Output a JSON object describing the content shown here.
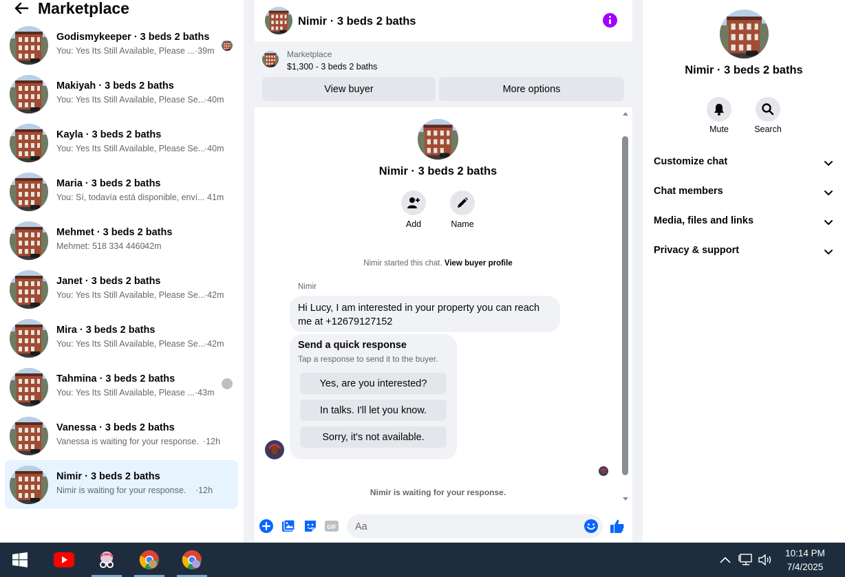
{
  "sidebar": {
    "title": "Marketplace",
    "conversations": [
      {
        "title": "Godismykeeper · 3 beds 2 baths",
        "sub": "You: Yes Its Still Available, Please ...",
        "time": "·39m"
      },
      {
        "title": "Makiyah · 3 beds 2 baths",
        "sub": "You: Yes Its Still Available, Please Se...",
        "time": "·40m"
      },
      {
        "title": "Kayla · 3 beds 2 baths",
        "sub": "You: Yes Its Still Available, Please Se...",
        "time": "·40m"
      },
      {
        "title": "Maria · 3 beds 2 baths",
        "sub": "You: Sí, todavía está disponible, enví...",
        "time": "41m"
      },
      {
        "title": "Mehmet · 3 beds 2 baths",
        "sub": "Mehmet: 518 334 4460",
        "time": "·42m"
      },
      {
        "title": "Janet · 3 beds 2 baths",
        "sub": "You: Yes Its Still Available, Please Se...",
        "time": "·42m"
      },
      {
        "title": "Mira · 3 beds 2 baths",
        "sub": "You: Yes Its Still Available, Please Se...",
        "time": "·42m"
      },
      {
        "title": "Tahmina · 3 beds 2 baths",
        "sub": "You: Yes Its Still Available, Please ...",
        "time": "·43m"
      },
      {
        "title": "Vanessa · 3 beds 2 baths",
        "sub": "Vanessa is waiting for your response.",
        "time": "·12h"
      },
      {
        "title": "Nimir · 3 beds 2 baths",
        "sub": "Nimir is waiting for your response.",
        "time": "·12h"
      }
    ]
  },
  "chat": {
    "title": "Nimir · 3 beds 2 baths",
    "marketplace_label": "Marketplace",
    "listing": "$1,300 - 3 beds 2 baths",
    "view_buyer": "View buyer",
    "more_options": "More options",
    "thread_name": "Nimir · 3 beds 2 baths",
    "add_label": "Add",
    "name_label": "Name",
    "started_text": "Nimir started this chat.",
    "view_profile": "View buyer profile",
    "sender": "Nimir",
    "message": "Hi Lucy, I am interested in your property you can reach me at +12679127152",
    "quick_title": "Send a quick response",
    "quick_sub": "Tap a response to send it to the buyer.",
    "quick_replies": [
      "Yes, are you interested?",
      "In talks. I'll let you know.",
      "Sorry, it's not available."
    ],
    "waiting": "Nimir is waiting for your response.",
    "composer_placeholder": "Aa"
  },
  "details": {
    "name": "Nimir · 3 beds 2 baths",
    "mute": "Mute",
    "search": "Search",
    "sections": [
      "Customize chat",
      "Chat members",
      "Media, files and links",
      "Privacy & support"
    ]
  },
  "taskbar": {
    "time": "10:14 PM",
    "date": "7/4/2025",
    "apps": [
      "windows-start",
      "youtube",
      "snipping-tool",
      "chrome",
      "chrome-profile"
    ]
  },
  "colors": {
    "accent": "#0866ff",
    "info": "#a100ff",
    "active_row": "#e7f3ff",
    "taskbar": "#1e2d3d"
  }
}
